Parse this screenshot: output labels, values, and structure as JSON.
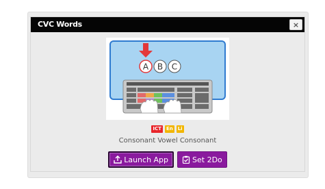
{
  "app": {
    "title": "CVC Words",
    "close_label": "×",
    "subtitle": "Consonant Vowel Consonant",
    "thumbnail": {
      "letters": [
        "A",
        "B",
        "C"
      ]
    },
    "badges": [
      {
        "label": "ICT",
        "color": "#e8262b"
      },
      {
        "label": "En",
        "color": "#f2b600"
      },
      {
        "label": "Li",
        "color": "#f2b600"
      }
    ],
    "buttons": {
      "launch_label": "Launch App",
      "set2do_label": "Set 2Do"
    }
  },
  "colors": {
    "title_bar": "#050505",
    "button_purple": "#8a1a9e",
    "screen_blue": "#a8d4f2",
    "screen_border": "#2f7bd0",
    "arrow_red": "#e3383a"
  }
}
